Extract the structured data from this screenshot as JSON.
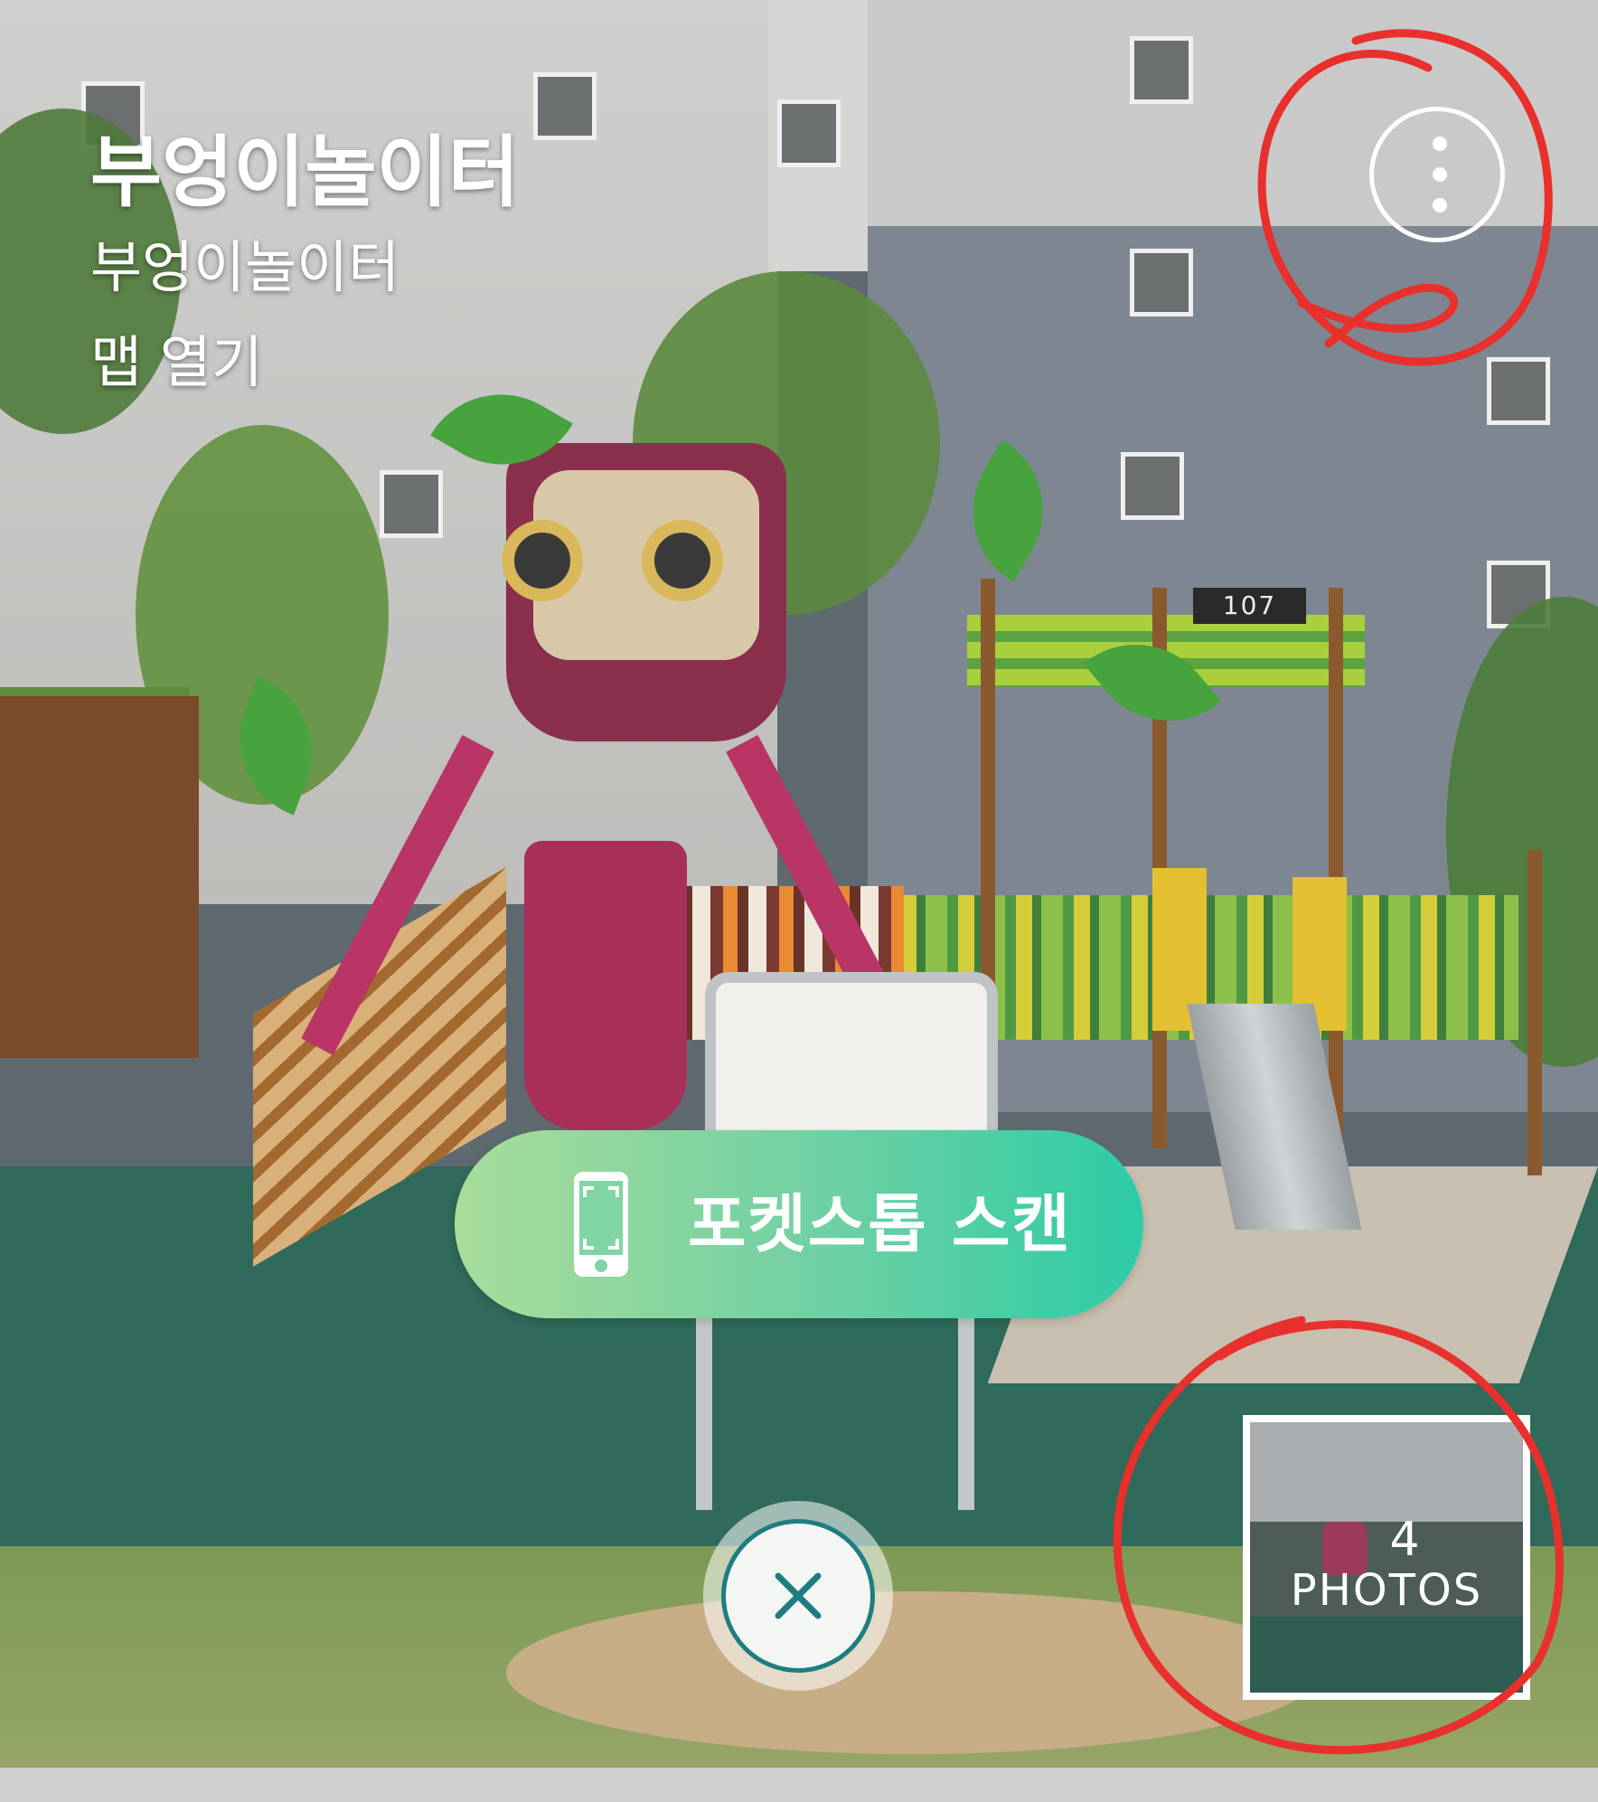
{
  "stop": {
    "title": "부엉이놀이터",
    "subtitle": "부엉이놀이터",
    "open_map_label": "맵 열기"
  },
  "background": {
    "building_sign": "107"
  },
  "scan_button": {
    "label": "포켓스톱 스캔",
    "icon": "phone-scan-icon"
  },
  "close_button": {
    "icon": "close-icon"
  },
  "menu_button": {
    "icon": "more-vertical-icon"
  },
  "photos": {
    "count": "4",
    "label": "PHOTOS"
  },
  "colors": {
    "scan_gradient_start": "#a8dd9a",
    "scan_gradient_end": "#2ccca6",
    "close_ring": "#1e7d80",
    "annotation": "#e8302c"
  }
}
